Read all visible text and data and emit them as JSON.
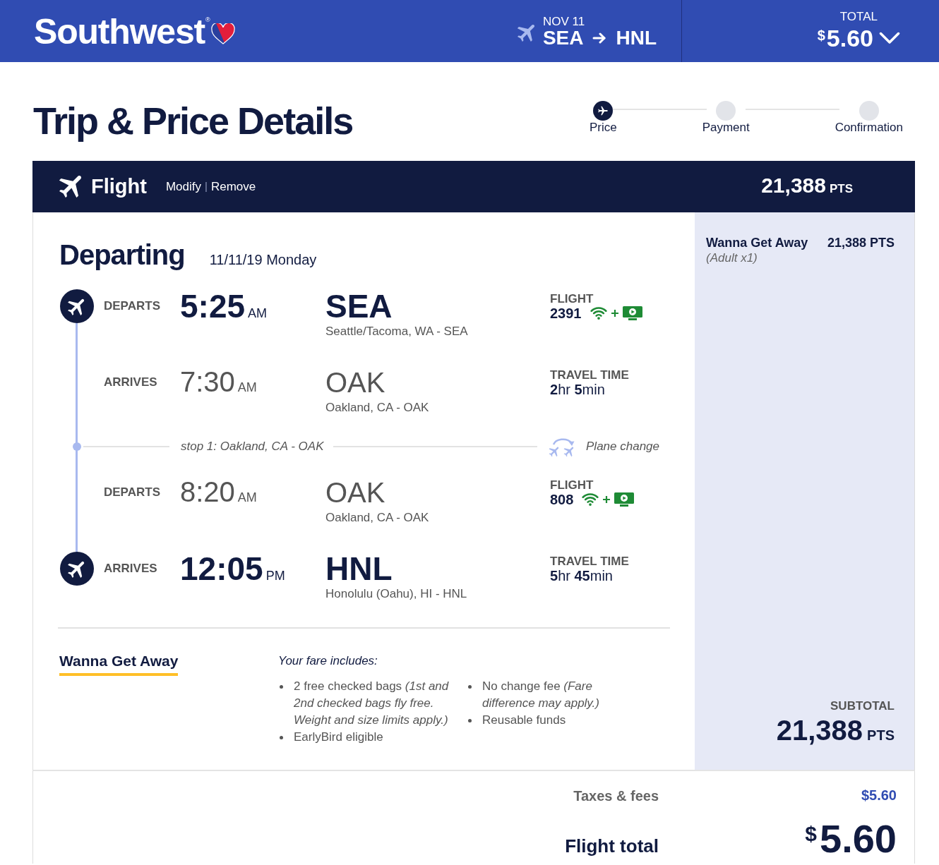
{
  "header": {
    "logo": {
      "wordmark": "Southwest",
      "registered": "®"
    },
    "trip": {
      "date": "NOV 11",
      "origin": "SEA",
      "destination": "HNL"
    },
    "total": {
      "label": "TOTAL",
      "currency": "$",
      "amount": "5.60"
    }
  },
  "title": "Trip & Price Details",
  "steps": [
    {
      "label": "Price",
      "selected": true
    },
    {
      "label": "Payment",
      "selected": false
    },
    {
      "label": "Confirmation",
      "selected": false
    }
  ],
  "flight_bar": {
    "title": "Flight",
    "actions": [
      "Modify",
      "Remove"
    ],
    "separator": "|",
    "points": "21,388",
    "unit": "PTS"
  },
  "departing": {
    "title": "Departing",
    "date": "11/11/19 Monday"
  },
  "itinerary": [
    {
      "kind": "endpoint",
      "label": "DEPARTS",
      "time": "5:25",
      "period": "AM",
      "airport": "SEA",
      "city": "Seattle/Tacoma, WA - SEA",
      "info": {
        "kind": "flight",
        "label": "FLIGHT",
        "value": "2391"
      }
    },
    {
      "kind": "connection",
      "label": "ARRIVES",
      "time": "7:30",
      "period": "AM",
      "airport": "OAK",
      "city": "Oakland, CA - OAK",
      "info": {
        "kind": "travel_time",
        "label": "TRAVEL TIME",
        "value": "**2**hr **5**min"
      }
    },
    {
      "kind": "stop",
      "text": "stop 1: Oakland, CA - OAK",
      "note": "Plane change"
    },
    {
      "kind": "connection",
      "label": "DEPARTS",
      "time": "8:20",
      "period": "AM",
      "airport": "OAK",
      "city": "Oakland, CA - OAK",
      "info": {
        "kind": "flight",
        "label": "FLIGHT",
        "value": "808"
      }
    },
    {
      "kind": "endpoint",
      "label": "ARRIVES",
      "time": "12:05",
      "period": "PM",
      "airport": "HNL",
      "city": "Honolulu (Oahu), HI - HNL",
      "info": {
        "kind": "travel_time",
        "label": "TRAVEL TIME",
        "value": "**5**hr **45**min"
      }
    }
  ],
  "fare": {
    "name": "Wanna Get Away",
    "includes_title": "Your fare includes:",
    "features": [
      "2 free checked bags *(1st and 2nd checked bags fly free. Weight and size limits apply.)*",
      "EarlyBird eligible",
      "No change fee *(Fare difference may apply.)*",
      "Reusable funds"
    ]
  },
  "summary": {
    "fare_name": "Wanna Get Away",
    "passengers": "(Adult x1)",
    "points": "21,388 PTS",
    "subtotal_label": "SUBTOTAL",
    "subtotal_points": "21,388",
    "subtotal_unit": "PTS"
  },
  "totals": {
    "taxes_label": "Taxes & fees",
    "taxes_amount": "$5.60",
    "total_label": "Flight total",
    "total_currency": "$",
    "total_amount": "5.60"
  }
}
